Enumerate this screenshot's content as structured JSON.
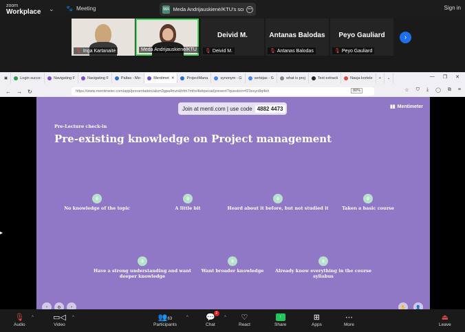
{
  "app": {
    "logo_top": "zoom",
    "logo_bottom": "Workplace",
    "meeting_label": "Meeting",
    "sign_in": "Sign in"
  },
  "share": {
    "initials": "MA",
    "text": "Meda Andrijauskienė/KTU's scree"
  },
  "participants": [
    {
      "name": "Inga Kartanaitė",
      "video": true
    },
    {
      "name": "Meda Andrijauskienė/KTU",
      "video": true,
      "active": true
    },
    {
      "name": "Deivid M.",
      "big": "Deivid M."
    },
    {
      "name": "Antanas Balodas",
      "big": "Antanas Balodas"
    },
    {
      "name": "Peyo Gauliard",
      "big": "Peyo Gauliard"
    }
  ],
  "browser": {
    "tabs": [
      "Login succe:",
      "Navigating F",
      "Navigating F",
      "Paltas - Me:",
      "Mentimet",
      "ProjectMana",
      "synonym - G",
      "vertėjas - G",
      "what is proj",
      "Text extracti",
      "Nauja kortele"
    ],
    "url": "https://www.mentimeter.com/app/presentation/alum3gpa4mznkhfm7mfrs4tsbpecat/present?question=f23esyn8q4eh",
    "zoom": "80%"
  },
  "slide": {
    "join_prefix": "Join at menti.com | use code",
    "code": "4882 4473",
    "brand": "Mentimeter",
    "kicker": "Pre-Lecture check-in",
    "title": "Pre-existing knowledge on Project management",
    "options": [
      {
        "count": "0",
        "label": "No knowledge of the topic"
      },
      {
        "count": "0",
        "label": "A little bit"
      },
      {
        "count": "0",
        "label": "Heard about it before, but not studied it"
      },
      {
        "count": "0",
        "label": "Taken a basic course"
      },
      {
        "count": "0",
        "label": "Have a strong understanding and want deeper knowledge"
      },
      {
        "count": "0",
        "label": "Want broader knowledge"
      },
      {
        "count": "0",
        "label": "Already know everything in the course syllabus"
      }
    ]
  },
  "toolbar": {
    "audio": "Audio",
    "video": "Video",
    "participants": "Participants",
    "participants_count": "63",
    "chat": "Chat",
    "chat_badge": "2",
    "react": "React",
    "share": "Share",
    "apps": "Apps",
    "more": "More",
    "leave": "Leave"
  }
}
